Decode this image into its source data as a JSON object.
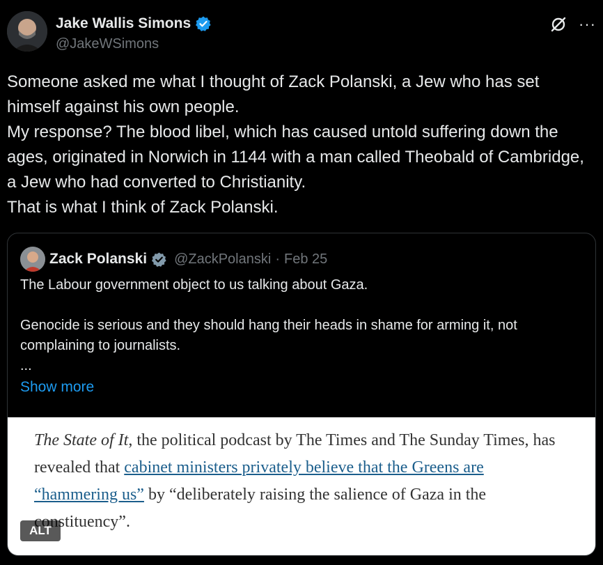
{
  "author": {
    "name": "Jake Wallis Simons",
    "handle": "@JakeWSimons"
  },
  "header_icons": [
    "grok-icon",
    "more-icon"
  ],
  "more_glyph": "···",
  "tweet_lines": [
    "Someone asked me what I thought of Zack Polanski, a Jew who has set himself against his own people.",
    "My response? The blood libel, which has caused untold suffering down the ages, originated in Norwich in 1144 with a man called Theobald of Cambridge, a Jew who had converted to Christianity.",
    "That is what I think of Zack Polanski."
  ],
  "quote": {
    "name": "Zack Polanski",
    "handle": "@ZackPolanski",
    "dot": "·",
    "date": "Feb 25",
    "line1": "The Labour government object to us talking about Gaza.",
    "line2": "Genocide is serious and they should hang their heads in shame for arming it, not complaining to journalists.",
    "ellipsis": "...",
    "show_more": "Show more",
    "image": {
      "title_italic": "The State of It",
      "text_a": ", the political podcast by The Times and The Sunday Times, has revealed that ",
      "link": "cabinet ministers privately believe that the Greens are “hammering us”",
      "text_b": " by “deliberately raising the salience of Gaza in the constituency”.",
      "alt_label": "ALT"
    }
  },
  "colors": {
    "background": "#000000",
    "text": "#e7e9ea",
    "muted": "#71767b",
    "link": "#1d9bf0",
    "verified": "#1d9bf0",
    "quote_verified": "#829aab",
    "border": "#2f3336"
  }
}
